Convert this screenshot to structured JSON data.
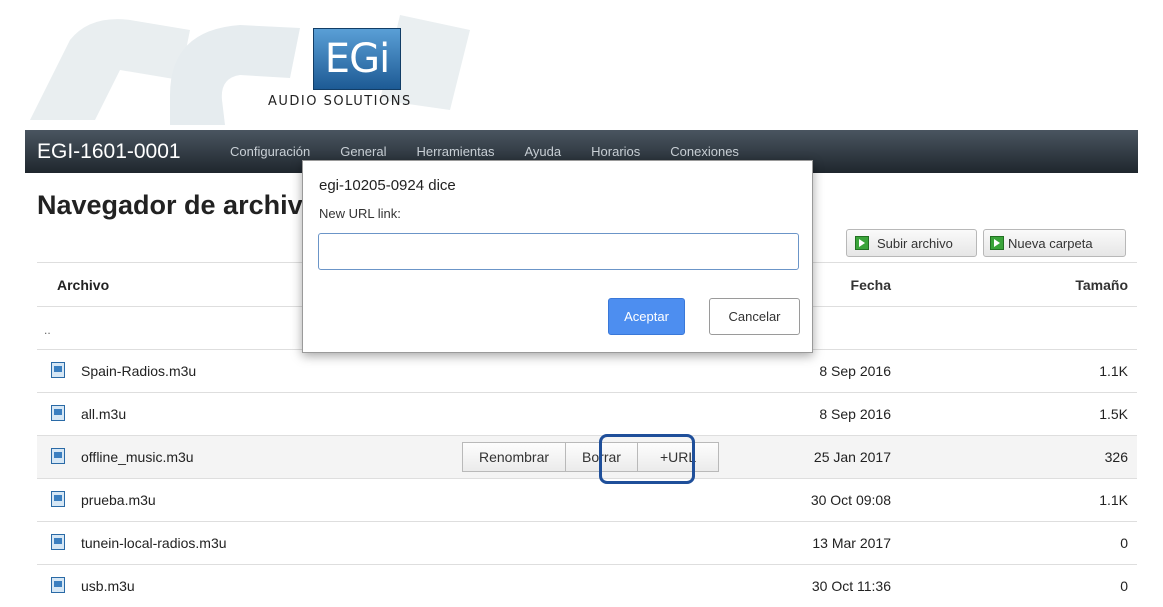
{
  "logo": {
    "mark": "EGi",
    "subtitle": "AUDIO SOLUTIONS"
  },
  "navbar": {
    "brand": "EGI-1601-0001",
    "items": [
      "Configuración",
      "General",
      "Herramientas",
      "Ayuda",
      "Horarios",
      "Conexiones"
    ]
  },
  "page": {
    "title": "Navegador de archivos"
  },
  "actions": {
    "upload_label": "Subir archivo",
    "new_folder_label": "Nueva carpeta"
  },
  "table": {
    "headers": {
      "name": "Archivo",
      "date": "Fecha",
      "size": "Tamaño"
    },
    "parent": "..",
    "rows": [
      {
        "name": "Spain-Radios.m3u",
        "date": "8 Sep 2016",
        "size": "1.1K"
      },
      {
        "name": "all.m3u",
        "date": "8 Sep 2016",
        "size": "1.5K"
      },
      {
        "name": "offline_music.m3u",
        "date": "25 Jan 2017",
        "size": "326"
      },
      {
        "name": "prueba.m3u",
        "date": "30 Oct 09:08",
        "size": "1.1K"
      },
      {
        "name": "tunein-local-radios.m3u",
        "date": "13 Mar 2017",
        "size": "0"
      },
      {
        "name": "usb.m3u",
        "date": "30 Oct 11:36",
        "size": "0"
      }
    ],
    "row_buttons": {
      "rename": "Renombrar",
      "delete": "Borrar",
      "add_url": "+URL"
    }
  },
  "dialog": {
    "title": "egi-10205-0924 dice",
    "message": "New URL link:",
    "input_value": "",
    "ok_label": "Aceptar",
    "cancel_label": "Cancelar"
  },
  "colors": {
    "navbar": "#2b333b",
    "accent": "#4d8ef0",
    "highlight": "#1f4f9a"
  }
}
